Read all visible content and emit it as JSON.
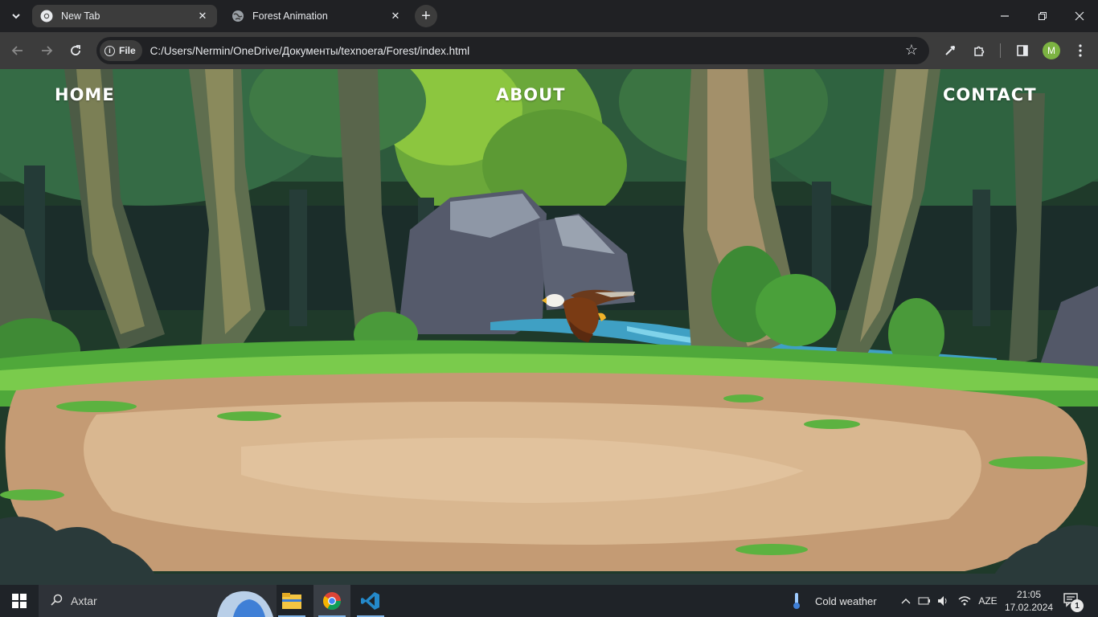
{
  "browser": {
    "tabs": [
      {
        "title": "New Tab",
        "favicon": "chrome-icon",
        "active": true
      },
      {
        "title": "Forest Animation",
        "favicon": "globe-icon",
        "active": false
      }
    ],
    "new_tab_label": "+",
    "address": {
      "scheme_chip": "File",
      "url": "C:/Users/Nermin/OneDrive/Документы/texnoera/Forest/index.html"
    },
    "profile_initial": "M"
  },
  "page": {
    "nav": {
      "home": "HOME",
      "about": "ABOUT",
      "contact": "CONTACT"
    },
    "scene": {
      "background": "pixel-art forest clearing",
      "sprite": "eagle"
    }
  },
  "taskbar": {
    "search_placeholder": "Axtar",
    "apps": [
      "cloud-widget-icon",
      "file-explorer-icon",
      "chrome-icon",
      "vscode-icon"
    ],
    "weather": "Cold weather",
    "language": "AZE",
    "time": "21:05",
    "date": "17.02.2024",
    "notifications": "1"
  },
  "colors": {
    "chrome_bg": "#202124",
    "toolbar_bg": "#3c3c3c",
    "taskbar_bg": "#1f2328",
    "profile": "#7cb342"
  }
}
